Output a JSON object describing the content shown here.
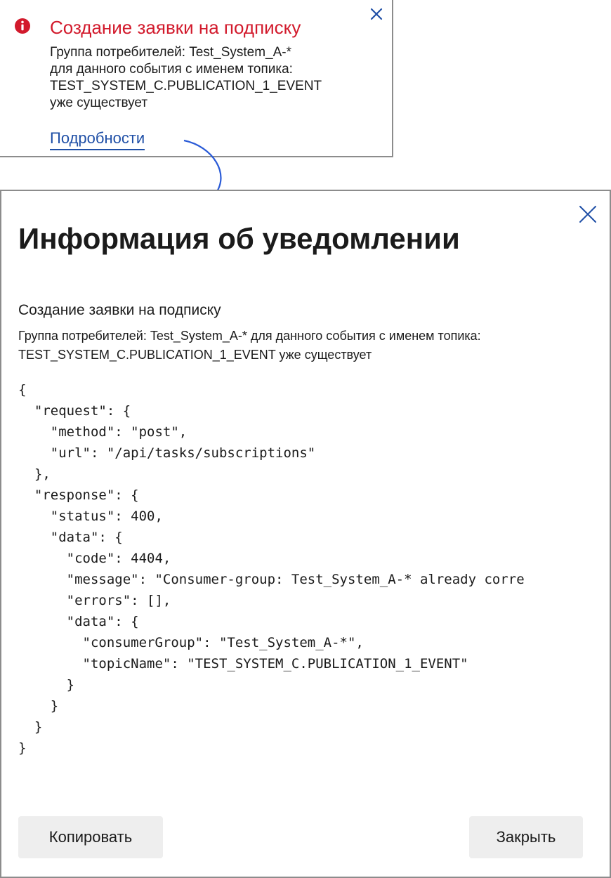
{
  "toast": {
    "icon": "error-icon",
    "title": "Создание заявки на подписку",
    "body_lines": [
      "Группа потребителей: Test_System_A-*",
      "для данного события с именем топика:",
      "TEST_SYSTEM_C.PUBLICATION_1_EVENT",
      "уже существует"
    ],
    "details_link": "Подробности",
    "close_icon": "close-icon"
  },
  "modal": {
    "title": "Информация об уведомлении",
    "subtitle": "Создание заявки на подписку",
    "description_lines": [
      "Группа потребителей: Test_System_A-* для данного события с именем топика:",
      "TEST_SYSTEM_C.PUBLICATION_1_EVENT уже существует"
    ],
    "json_lines": [
      "{",
      "  \"request\": {",
      "    \"method\": \"post\",",
      "    \"url\": \"/api/tasks/subscriptions\"",
      "  },",
      "  \"response\": {",
      "    \"status\": 400,",
      "    \"data\": {",
      "      \"code\": 4404,",
      "      \"message\": \"Consumer-group: Test_System_A-* already corre",
      "      \"errors\": [],",
      "      \"data\": {",
      "        \"consumerGroup\": \"Test_System_A-*\",",
      "        \"topicName\": \"TEST_SYSTEM_C.PUBLICATION_1_EVENT\"",
      "      }",
      "    }",
      "  }",
      "}"
    ],
    "copy_button": "Копировать",
    "close_button": "Закрыть",
    "close_icon": "close-icon"
  },
  "colors": {
    "error_red": "#d21a2c",
    "link_blue": "#1f4fa6",
    "button_bg": "#eeeeee",
    "border_gray": "#8c8c8c"
  }
}
